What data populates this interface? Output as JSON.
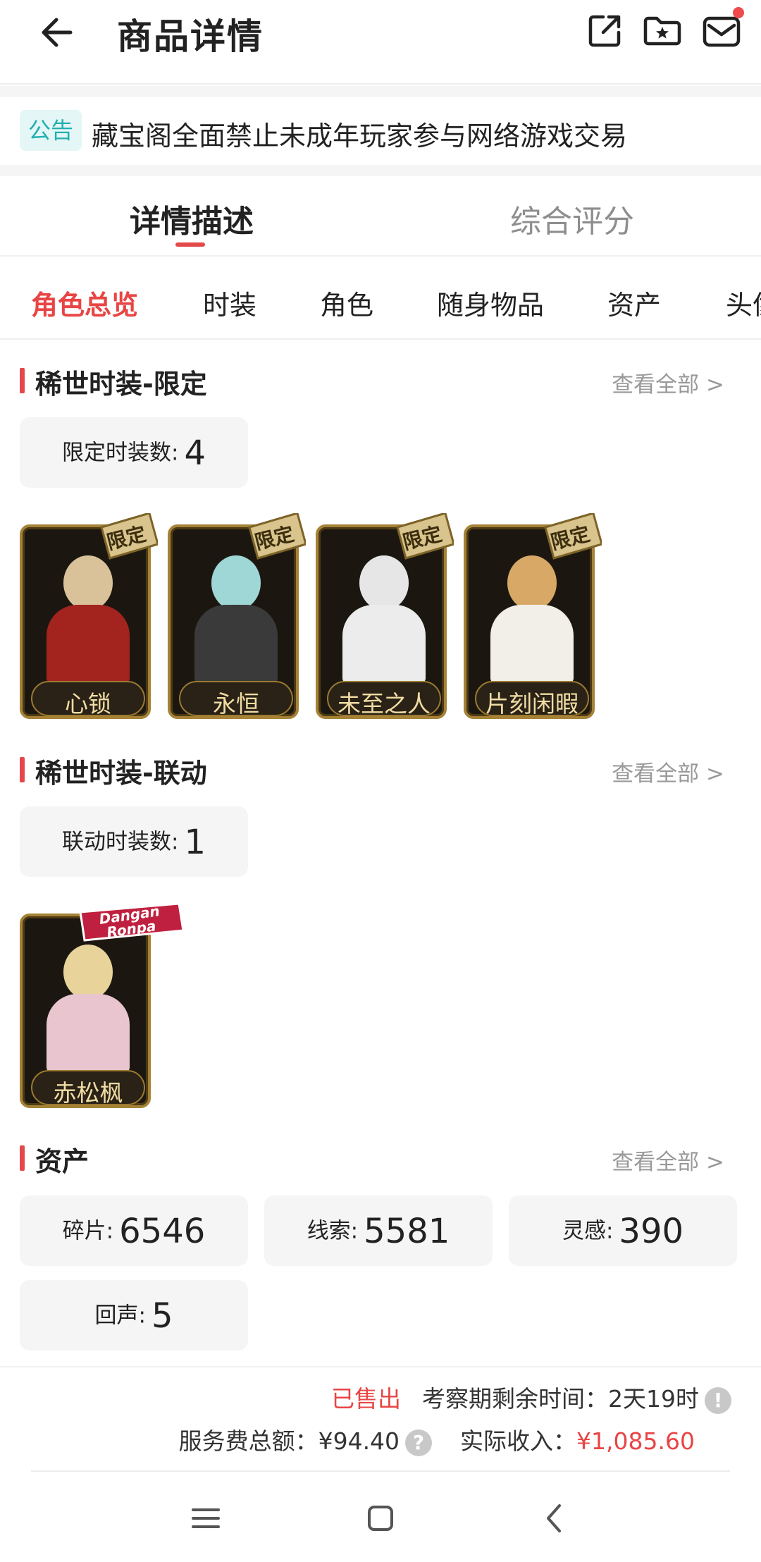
{
  "header": {
    "title": "商品详情",
    "icons": [
      "back-arrow-icon",
      "share-icon",
      "favorite-folder-icon",
      "message-icon"
    ]
  },
  "notice": {
    "tag": "公告",
    "text": "藏宝阁全面禁止未成年玩家参与网络游戏交易"
  },
  "tabs": [
    {
      "label": "详情描述",
      "active": true
    },
    {
      "label": "综合评分",
      "active": false
    }
  ],
  "subtabs": [
    {
      "label": "角色总览",
      "active": true
    },
    {
      "label": "时装",
      "active": false
    },
    {
      "label": "角色",
      "active": false
    },
    {
      "label": "随身物品",
      "active": false
    },
    {
      "label": "资产",
      "active": false
    },
    {
      "label": "头像",
      "active": false
    }
  ],
  "sections": {
    "limited": {
      "title": "稀世时装-限定",
      "view_all": "查看全部 >",
      "count_label": "限定时装数:",
      "count_value": "4",
      "badge": "限定",
      "items": [
        "心锁",
        "永恒",
        "未至之人",
        "片刻闲暇"
      ]
    },
    "collab": {
      "title": "稀世时装-联动",
      "view_all": "查看全部 >",
      "count_label": "联动时装数:",
      "count_value": "1",
      "badge": "Dangan Ronpa",
      "items": [
        "赤松枫"
      ]
    },
    "assets": {
      "title": "资产",
      "view_all": "查看全部 >",
      "stats": [
        {
          "label": "碎片:",
          "value": "6546"
        },
        {
          "label": "线索:",
          "value": "5581"
        },
        {
          "label": "灵感:",
          "value": "390"
        },
        {
          "label": "回声:",
          "value": "5"
        }
      ]
    }
  },
  "footer": {
    "status": "已售出",
    "period_label": "考察期剩余时间：",
    "period_value": "2天19时",
    "fee_label": "服务费总额：",
    "fee_value": "¥94.40",
    "income_label": "实际收入：",
    "income_value": "¥1,085.60",
    "info_icon": "!",
    "help_icon": "?"
  },
  "colors": {
    "accent": "#e84545",
    "notice_tag_bg": "#e4f6f6",
    "notice_tag_text": "#21b0b0",
    "card_gold": "#a58236"
  }
}
